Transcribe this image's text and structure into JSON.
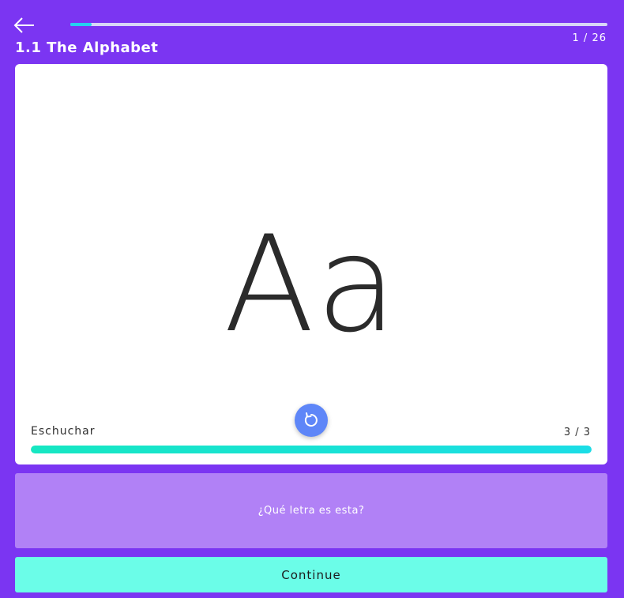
{
  "header": {
    "back_icon": "arrow-left-icon",
    "lesson_title": "1.1 The Alphabet",
    "page_counter": "1 / 26",
    "progress": 0.04
  },
  "card": {
    "letter": "Aa",
    "replay_icon": "replay-icon",
    "listen_label": "Eschuchar",
    "listen_counter": "3 / 3",
    "listen_progress": 1.0
  },
  "question": {
    "text": "¿Qué letra es esta?"
  },
  "footer": {
    "continue_label": "Continue"
  },
  "colors": {
    "background": "#7b35f2",
    "accent_cyan": "#25d2f0",
    "continue_bg": "#6bfde8",
    "question_bg": "#b181f6",
    "replay_bg": "#5e86f8"
  }
}
